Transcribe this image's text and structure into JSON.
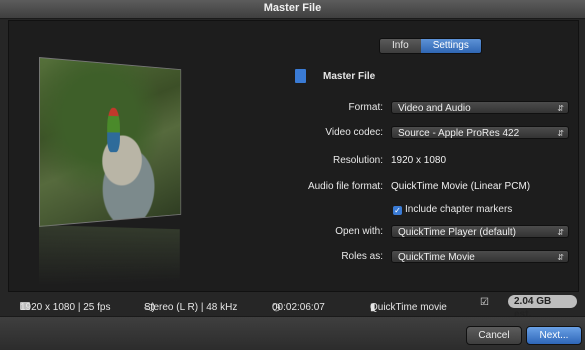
{
  "window": {
    "title": "Master File"
  },
  "tabs": [
    {
      "label": "Info",
      "selected": false
    },
    {
      "label": "Settings",
      "selected": true
    }
  ],
  "settings": {
    "heading": "Master File",
    "format": {
      "label": "Format:",
      "value": "Video and Audio"
    },
    "video_codec": {
      "label": "Video codec:",
      "value": "Source - Apple ProRes 422"
    },
    "resolution": {
      "label": "Resolution:",
      "value": "1920 x 1080"
    },
    "audio_file_format": {
      "label": "Audio file format:",
      "value": "QuickTime Movie (Linear PCM)"
    },
    "chapter_markers": {
      "label": "Include chapter markers",
      "checked": true
    },
    "open_with": {
      "label": "Open with:",
      "value": "QuickTime Player (default)"
    },
    "roles_as": {
      "label": "Roles as:",
      "value": "QuickTime Movie"
    }
  },
  "status": {
    "video": "1920 x 1080 | 25 fps",
    "audio": "Stereo (L R) | 48 kHz",
    "duration": "00:02:06:07",
    "file_type": "QuickTime movie",
    "size": "2.04 GB est."
  },
  "buttons": {
    "cancel": "Cancel",
    "next": "Next..."
  },
  "colors": {
    "accent": "#3a7bd5",
    "background": "#262626"
  }
}
